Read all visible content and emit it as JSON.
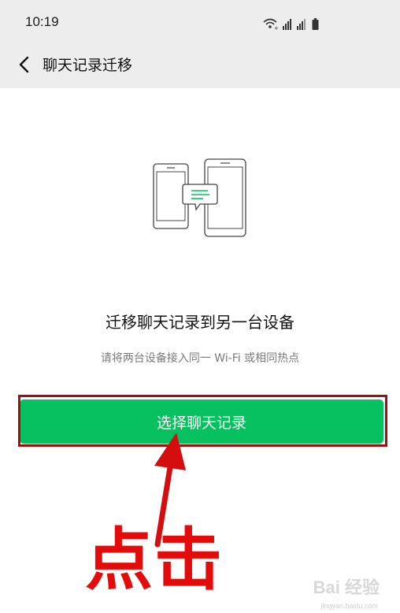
{
  "status_bar": {
    "time": "10:19",
    "icons": [
      "wifi-icon",
      "signal-icon",
      "signal-icon",
      "battery-icon"
    ]
  },
  "nav": {
    "back_icon": "chevron-left-icon",
    "title": "聊天记录迁移"
  },
  "main": {
    "illustration_icon": "phones-transfer-icon",
    "headline": "迁移聊天记录到另一台设备",
    "subtext": "请将两台设备接入同一 Wi-Fi 或相同热点",
    "button_label": "选择聊天记录"
  },
  "annotation": {
    "label": "点击",
    "color": "#e40b0b"
  },
  "watermark": {
    "brand": "Bai 经验",
    "url": "jingyan.baidu.com"
  },
  "colors": {
    "accent": "#07c160",
    "topbar_bg": "#ededed",
    "highlight": "#a00f10"
  }
}
